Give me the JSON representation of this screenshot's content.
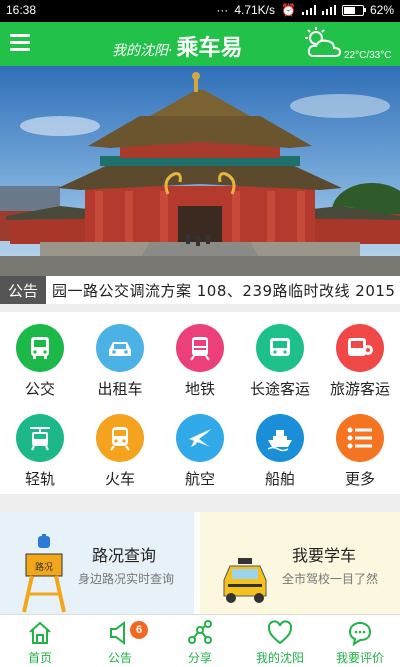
{
  "status_bar": {
    "time": "16:38",
    "network_speed": "4.71K/s",
    "battery": "62%",
    "battery_level": 0.62
  },
  "app": {
    "title_prefix": "我的沈阳·",
    "title_main": "乘车易",
    "temperature": "22°C/33°C"
  },
  "notice": {
    "tag": "公告",
    "text": "园一路公交调流方案 108、239路临时改线   2015"
  },
  "services": [
    {
      "label": "公交",
      "icon": "bus-icon",
      "color": "#1cb84a"
    },
    {
      "label": "出租车",
      "icon": "taxi-icon",
      "color": "#4cb2e6"
    },
    {
      "label": "地铁",
      "icon": "subway-icon",
      "color": "#ec407a"
    },
    {
      "label": "长途客运",
      "icon": "coach-icon",
      "color": "#1ec08a"
    },
    {
      "label": "旅游客运",
      "icon": "tour-bus-icon",
      "color": "#f04747"
    },
    {
      "label": "轻轨",
      "icon": "light-rail-icon",
      "color": "#1cb88a"
    },
    {
      "label": "火车",
      "icon": "train-icon",
      "color": "#f5a21e"
    },
    {
      "label": "航空",
      "icon": "airplane-icon",
      "color": "#32a9e8"
    },
    {
      "label": "船舶",
      "icon": "ship-icon",
      "color": "#1a8fd8"
    },
    {
      "label": "更多",
      "icon": "more-icon",
      "color": "#f57422"
    }
  ],
  "cards": [
    {
      "title": "路况查询",
      "subtitle": "身边路况实时查询",
      "sign_text": "路况"
    },
    {
      "title": "我要学车",
      "subtitle": "全市驾校一目了然"
    }
  ],
  "tabs": [
    {
      "label": "首页",
      "icon": "home-icon"
    },
    {
      "label": "公告",
      "icon": "announcement-icon",
      "badge": "6"
    },
    {
      "label": "分享",
      "icon": "share-icon"
    },
    {
      "label": "我的沈阳",
      "icon": "heart-icon"
    },
    {
      "label": "我要评价",
      "icon": "comment-icon"
    }
  ],
  "colors": {
    "brand_green": "#22c24a",
    "tab_green": "#22b24a",
    "badge_orange": "#f26722"
  }
}
